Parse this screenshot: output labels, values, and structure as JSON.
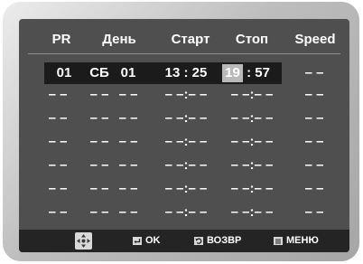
{
  "header": {
    "pr": "PR",
    "day": "День",
    "start": "Старт",
    "stop": "Стоп",
    "speed": "Speed"
  },
  "selected_row": {
    "pr": "01",
    "day": "СБ",
    "date": "01",
    "start": "13 : 25",
    "stop_hour": "19",
    "stop_rest": ": 57",
    "speed": "– –"
  },
  "empty_rows": [
    {
      "pr": "– –",
      "day": "– –",
      "date": "– –",
      "start": "– –:– –",
      "stop": "– –:– –",
      "speed": "– –"
    },
    {
      "pr": "– –",
      "day": "– –",
      "date": "– –",
      "start": "– –:– –",
      "stop": "– –:– –",
      "speed": "– –"
    },
    {
      "pr": "– –",
      "day": "– –",
      "date": "– –",
      "start": "– –:– –",
      "stop": "– –:– –",
      "speed": "– –"
    },
    {
      "pr": "– –",
      "day": "– –",
      "date": "– –",
      "start": "– –:– –",
      "stop": "– –:– –",
      "speed": "– –"
    },
    {
      "pr": "– –",
      "day": "– –",
      "date": "– –",
      "start": "– –:– –",
      "stop": "– –:– –",
      "speed": "– –"
    },
    {
      "pr": "– –",
      "day": "– –",
      "date": "– –",
      "start": "– –:– –",
      "stop": "– –:– –",
      "speed": "– –"
    }
  ],
  "footer": {
    "ok": "OK",
    "back": "ВОЗВР",
    "menu": "МЕНЮ"
  },
  "icons": {
    "navigate": "dpad-icon",
    "ok": "enter-icon",
    "back": "return-icon",
    "menu": "menu-icon"
  }
}
